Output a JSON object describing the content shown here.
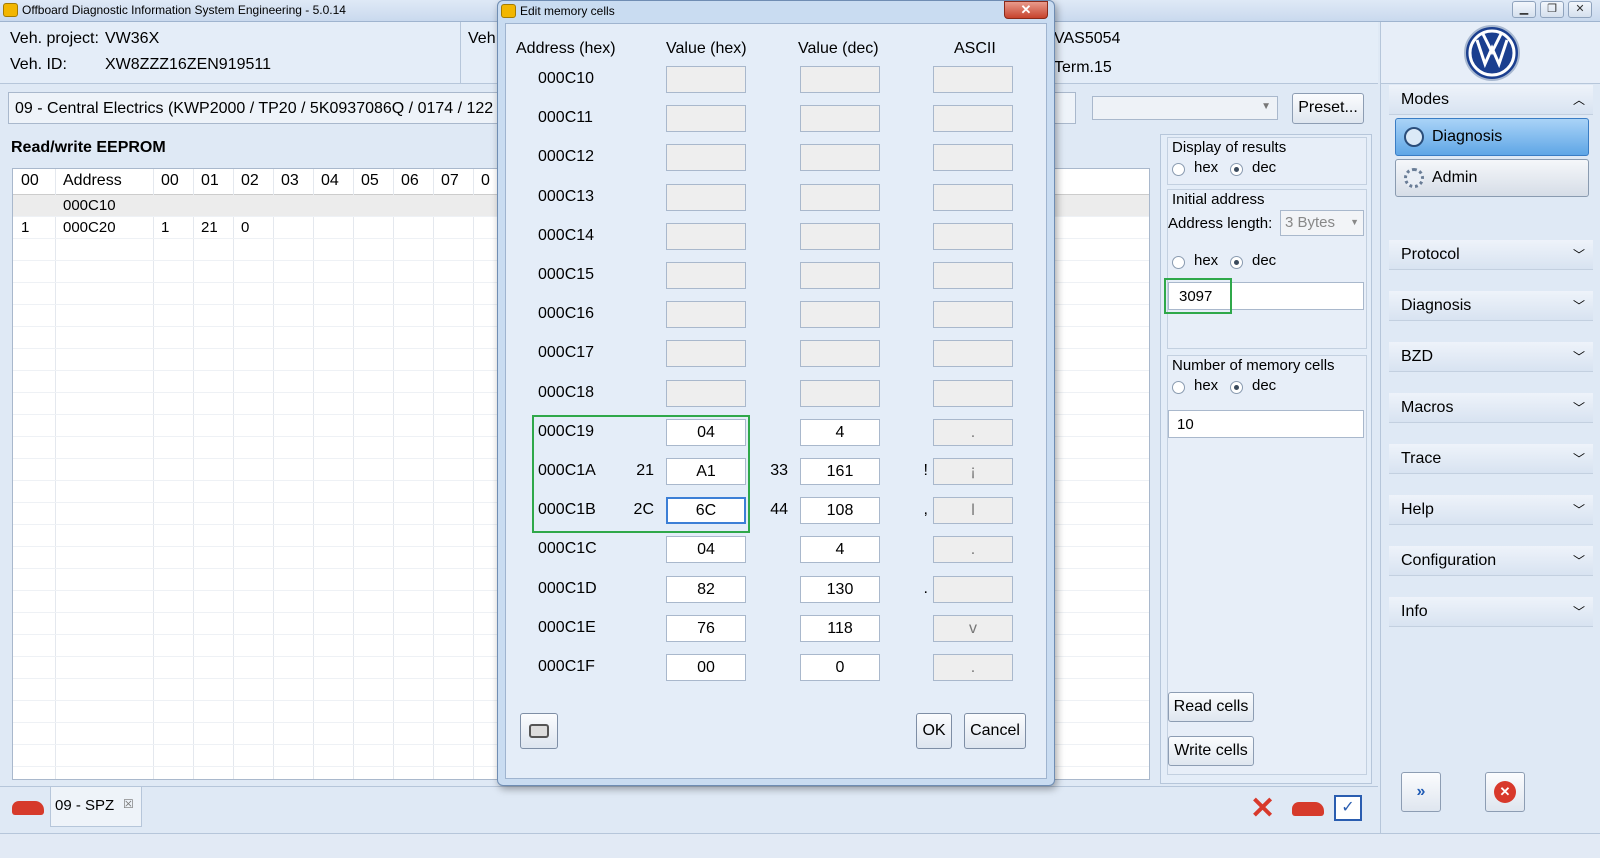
{
  "window": {
    "title": "Offboard Diagnostic Information System Engineering - 5.0.14",
    "buttons": [
      "▁",
      "❐",
      "✕"
    ]
  },
  "header": {
    "veh_project_label": "Veh. project:",
    "veh_project_value": "VW36X",
    "veh_id_label": "Veh. ID:",
    "veh_id_value": "XW8ZZZ16ZEN919511",
    "veh_label_partial": "Veh",
    "interface_value": "VAS5054",
    "terminal_value": "Term.15"
  },
  "control_bar": {
    "ecu_text": "09 - Central Electrics  (KWP2000 / TP20 / 5K0937086Q  / 0174 / 122",
    "preset_label": "Preset..."
  },
  "main": {
    "section_title": "Read/write EEPROM",
    "grid_headers": [
      "00",
      "Address",
      "00",
      "01",
      "02",
      "03",
      "04",
      "05",
      "06",
      "07",
      "0"
    ],
    "grid_rows": [
      [
        "",
        "000C10",
        "",
        "",
        "",
        "",
        "",
        "",
        "",
        "",
        ""
      ],
      [
        "1",
        "000C20",
        "1",
        "21",
        "0",
        "",
        "",
        "",
        "",
        "",
        ""
      ]
    ]
  },
  "options": {
    "display_results_title": "Display of results",
    "hex_label": "hex",
    "dec_label": "dec",
    "initial_address_title": "Initial address",
    "address_length_label": "Address length:",
    "address_length_value": "3 Bytes",
    "initial_address_value": "3097",
    "num_cells_title": "Number of memory cells",
    "num_cells_value": "10",
    "read_cells_label": "Read cells",
    "write_cells_label": "Write cells"
  },
  "sidebar": {
    "modes_label": "Modes",
    "mode_buttons": [
      "Diagnosis",
      "Admin"
    ],
    "sections": [
      "Protocol",
      "Diagnosis",
      "BZD",
      "Macros",
      "Trace",
      "Help",
      "Configuration",
      "Info"
    ]
  },
  "bottom": {
    "tab_label": "09 - SPZ",
    "tab_close": "☒"
  },
  "dialog": {
    "title": "Edit memory cells",
    "close": "✕",
    "col_address": "Address (hex)",
    "col_value_hex": "Value (hex)",
    "col_value_dec": "Value (dec)",
    "col_ascii": "ASCII",
    "rows": [
      {
        "addr": "000C10",
        "left": "",
        "hex": "",
        "mid": "",
        "dec": "",
        "right": "",
        "ascii": "",
        "filled": false
      },
      {
        "addr": "000C11",
        "left": "",
        "hex": "",
        "mid": "",
        "dec": "",
        "right": "",
        "ascii": "",
        "filled": false
      },
      {
        "addr": "000C12",
        "left": "",
        "hex": "",
        "mid": "",
        "dec": "",
        "right": "",
        "ascii": "",
        "filled": false
      },
      {
        "addr": "000C13",
        "left": "",
        "hex": "",
        "mid": "",
        "dec": "",
        "right": "",
        "ascii": "",
        "filled": false
      },
      {
        "addr": "000C14",
        "left": "",
        "hex": "",
        "mid": "",
        "dec": "",
        "right": "",
        "ascii": "",
        "filled": false
      },
      {
        "addr": "000C15",
        "left": "",
        "hex": "",
        "mid": "",
        "dec": "",
        "right": "",
        "ascii": "",
        "filled": false
      },
      {
        "addr": "000C16",
        "left": "",
        "hex": "",
        "mid": "",
        "dec": "",
        "right": "",
        "ascii": "",
        "filled": false
      },
      {
        "addr": "000C17",
        "left": "",
        "hex": "",
        "mid": "",
        "dec": "",
        "right": "",
        "ascii": "",
        "filled": false
      },
      {
        "addr": "000C18",
        "left": "",
        "hex": "",
        "mid": "",
        "dec": "",
        "right": "",
        "ascii": "",
        "filled": false
      },
      {
        "addr": "000C19",
        "left": "",
        "hex": "04",
        "mid": "",
        "dec": "4",
        "right": "",
        "ascii": ".",
        "filled": true
      },
      {
        "addr": "000C1A",
        "left": "21",
        "hex": "A1",
        "mid": "33",
        "dec": "161",
        "right": "!",
        "ascii": "¡",
        "filled": true
      },
      {
        "addr": "000C1B",
        "left": "2C",
        "hex": "6C",
        "mid": "44",
        "dec": "108",
        "right": ",",
        "ascii": "l",
        "filled": true
      },
      {
        "addr": "000C1C",
        "left": "",
        "hex": "04",
        "mid": "",
        "dec": "4",
        "right": "",
        "ascii": ".",
        "filled": true
      },
      {
        "addr": "000C1D",
        "left": "",
        "hex": "82",
        "mid": "",
        "dec": "130",
        "right": ".",
        "ascii": "",
        "filled": true
      },
      {
        "addr": "000C1E",
        "left": "",
        "hex": "76",
        "mid": "",
        "dec": "118",
        "right": "",
        "ascii": "v",
        "filled": true
      },
      {
        "addr": "000C1F",
        "left": "",
        "hex": "00",
        "mid": "",
        "dec": "0",
        "right": "",
        "ascii": ".",
        "filled": true
      }
    ],
    "ok_label": "OK",
    "cancel_label": "Cancel"
  },
  "colors": {
    "highlight_green": "#2fa84a",
    "focus_blue": "#3c7fd6",
    "close_red": "#c7432d"
  }
}
